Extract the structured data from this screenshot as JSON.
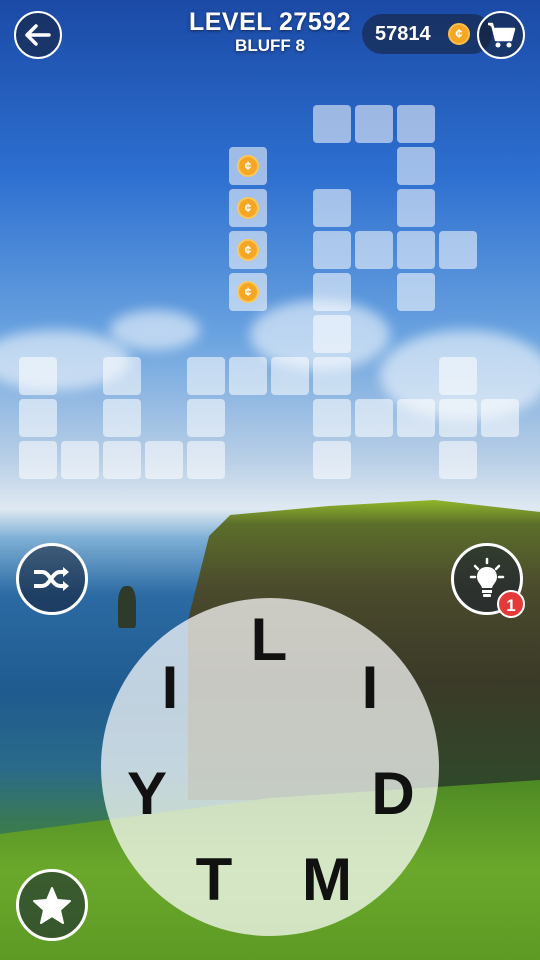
{
  "header": {
    "level": "LEVEL 27592",
    "subtitle": "BLUFF 8",
    "coins": "57814",
    "coin_symbol": "¢"
  },
  "icons": {
    "back": "back-arrow-icon",
    "shop": "shopping-cart-icon",
    "shuffle": "shuffle-icon",
    "hint": "lightbulb-icon",
    "star": "star-icon"
  },
  "hint": {
    "badge": "1"
  },
  "grid": {
    "coin_symbol": "¢",
    "coin_count": 4,
    "cell_color": "rgba(255,255,255,0.55)"
  },
  "wheel": {
    "letters": [
      "L",
      "I",
      "D",
      "M",
      "T",
      "Y",
      "I"
    ]
  },
  "colors": {
    "coin": "#f5a623",
    "badge": "#e63a3a",
    "button_bg": "rgba(20,30,50,0.55)"
  }
}
